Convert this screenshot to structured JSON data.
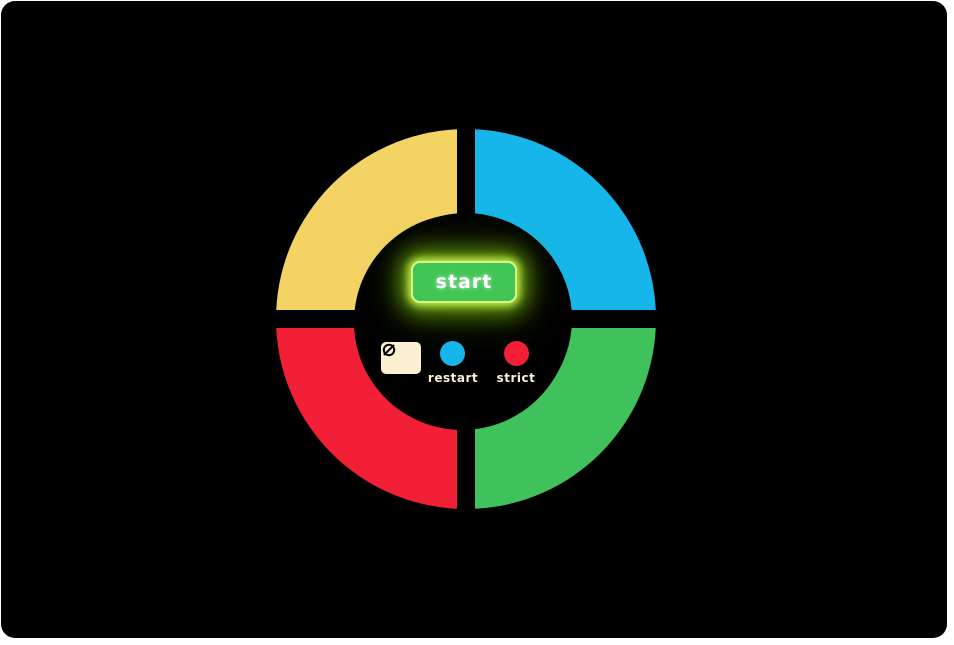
{
  "colors": {
    "yellow": "#f4d365",
    "blue": "#17b6ea",
    "red": "#f21f36",
    "green": "#3fc25c",
    "start_bg": "#41c656",
    "cream": "#fbf0d2",
    "background": "#000000"
  },
  "pads": [
    "yellow-pad",
    "blue-pad",
    "red-pad",
    "green-pad"
  ],
  "controls": {
    "start_label": "start",
    "power_icon": "power-off-icon",
    "restart_label": "restart",
    "strict_label": "strict"
  }
}
